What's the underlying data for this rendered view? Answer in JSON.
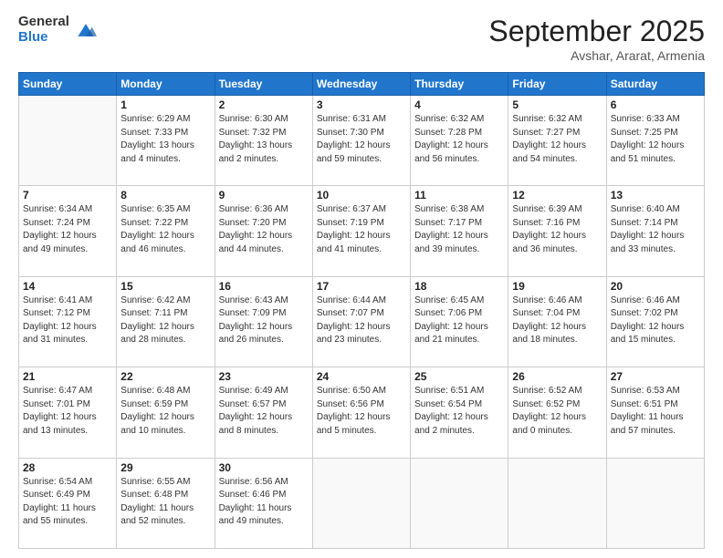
{
  "header": {
    "logo_general": "General",
    "logo_blue": "Blue",
    "month_title": "September 2025",
    "location": "Avshar, Ararat, Armenia"
  },
  "days_of_week": [
    "Sunday",
    "Monday",
    "Tuesday",
    "Wednesday",
    "Thursday",
    "Friday",
    "Saturday"
  ],
  "weeks": [
    [
      {
        "day": "",
        "info": ""
      },
      {
        "day": "1",
        "info": "Sunrise: 6:29 AM\nSunset: 7:33 PM\nDaylight: 13 hours\nand 4 minutes."
      },
      {
        "day": "2",
        "info": "Sunrise: 6:30 AM\nSunset: 7:32 PM\nDaylight: 13 hours\nand 2 minutes."
      },
      {
        "day": "3",
        "info": "Sunrise: 6:31 AM\nSunset: 7:30 PM\nDaylight: 12 hours\nand 59 minutes."
      },
      {
        "day": "4",
        "info": "Sunrise: 6:32 AM\nSunset: 7:28 PM\nDaylight: 12 hours\nand 56 minutes."
      },
      {
        "day": "5",
        "info": "Sunrise: 6:32 AM\nSunset: 7:27 PM\nDaylight: 12 hours\nand 54 minutes."
      },
      {
        "day": "6",
        "info": "Sunrise: 6:33 AM\nSunset: 7:25 PM\nDaylight: 12 hours\nand 51 minutes."
      }
    ],
    [
      {
        "day": "7",
        "info": "Sunrise: 6:34 AM\nSunset: 7:24 PM\nDaylight: 12 hours\nand 49 minutes."
      },
      {
        "day": "8",
        "info": "Sunrise: 6:35 AM\nSunset: 7:22 PM\nDaylight: 12 hours\nand 46 minutes."
      },
      {
        "day": "9",
        "info": "Sunrise: 6:36 AM\nSunset: 7:20 PM\nDaylight: 12 hours\nand 44 minutes."
      },
      {
        "day": "10",
        "info": "Sunrise: 6:37 AM\nSunset: 7:19 PM\nDaylight: 12 hours\nand 41 minutes."
      },
      {
        "day": "11",
        "info": "Sunrise: 6:38 AM\nSunset: 7:17 PM\nDaylight: 12 hours\nand 39 minutes."
      },
      {
        "day": "12",
        "info": "Sunrise: 6:39 AM\nSunset: 7:16 PM\nDaylight: 12 hours\nand 36 minutes."
      },
      {
        "day": "13",
        "info": "Sunrise: 6:40 AM\nSunset: 7:14 PM\nDaylight: 12 hours\nand 33 minutes."
      }
    ],
    [
      {
        "day": "14",
        "info": "Sunrise: 6:41 AM\nSunset: 7:12 PM\nDaylight: 12 hours\nand 31 minutes."
      },
      {
        "day": "15",
        "info": "Sunrise: 6:42 AM\nSunset: 7:11 PM\nDaylight: 12 hours\nand 28 minutes."
      },
      {
        "day": "16",
        "info": "Sunrise: 6:43 AM\nSunset: 7:09 PM\nDaylight: 12 hours\nand 26 minutes."
      },
      {
        "day": "17",
        "info": "Sunrise: 6:44 AM\nSunset: 7:07 PM\nDaylight: 12 hours\nand 23 minutes."
      },
      {
        "day": "18",
        "info": "Sunrise: 6:45 AM\nSunset: 7:06 PM\nDaylight: 12 hours\nand 21 minutes."
      },
      {
        "day": "19",
        "info": "Sunrise: 6:46 AM\nSunset: 7:04 PM\nDaylight: 12 hours\nand 18 minutes."
      },
      {
        "day": "20",
        "info": "Sunrise: 6:46 AM\nSunset: 7:02 PM\nDaylight: 12 hours\nand 15 minutes."
      }
    ],
    [
      {
        "day": "21",
        "info": "Sunrise: 6:47 AM\nSunset: 7:01 PM\nDaylight: 12 hours\nand 13 minutes."
      },
      {
        "day": "22",
        "info": "Sunrise: 6:48 AM\nSunset: 6:59 PM\nDaylight: 12 hours\nand 10 minutes."
      },
      {
        "day": "23",
        "info": "Sunrise: 6:49 AM\nSunset: 6:57 PM\nDaylight: 12 hours\nand 8 minutes."
      },
      {
        "day": "24",
        "info": "Sunrise: 6:50 AM\nSunset: 6:56 PM\nDaylight: 12 hours\nand 5 minutes."
      },
      {
        "day": "25",
        "info": "Sunrise: 6:51 AM\nSunset: 6:54 PM\nDaylight: 12 hours\nand 2 minutes."
      },
      {
        "day": "26",
        "info": "Sunrise: 6:52 AM\nSunset: 6:52 PM\nDaylight: 12 hours\nand 0 minutes."
      },
      {
        "day": "27",
        "info": "Sunrise: 6:53 AM\nSunset: 6:51 PM\nDaylight: 11 hours\nand 57 minutes."
      }
    ],
    [
      {
        "day": "28",
        "info": "Sunrise: 6:54 AM\nSunset: 6:49 PM\nDaylight: 11 hours\nand 55 minutes."
      },
      {
        "day": "29",
        "info": "Sunrise: 6:55 AM\nSunset: 6:48 PM\nDaylight: 11 hours\nand 52 minutes."
      },
      {
        "day": "30",
        "info": "Sunrise: 6:56 AM\nSunset: 6:46 PM\nDaylight: 11 hours\nand 49 minutes."
      },
      {
        "day": "",
        "info": ""
      },
      {
        "day": "",
        "info": ""
      },
      {
        "day": "",
        "info": ""
      },
      {
        "day": "",
        "info": ""
      }
    ]
  ]
}
